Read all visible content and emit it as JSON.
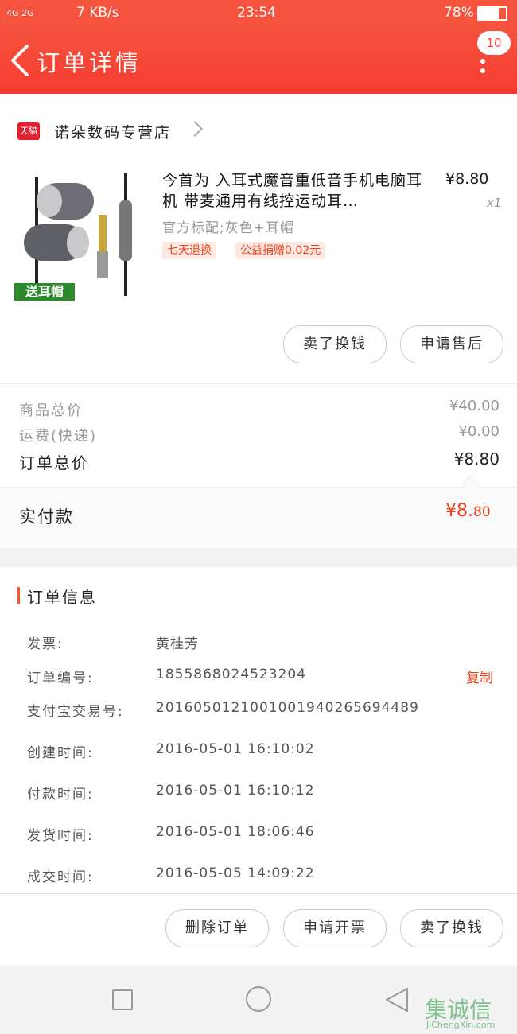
{
  "status_bar": {
    "signal_left": "4G 2G",
    "speed": "7 KB/s",
    "time": "23:54",
    "battery": "78%"
  },
  "header": {
    "title": "订单详情",
    "badge": "10"
  },
  "shop": {
    "logo_text": "天猫",
    "name": "诺朵数码专营店"
  },
  "product": {
    "thumb_label": "送耳帽",
    "name": "今首为 入耳式魔音重低音手机电脑耳机 带麦通用有线控运动耳…",
    "price": "¥8.80",
    "qty": "x1",
    "spec": "官方标配;灰色+耳帽",
    "tags": [
      "七天退换",
      "公益捐赠0.02元"
    ]
  },
  "item_buttons": {
    "sell": "卖了换钱",
    "after_sale": "申请售后"
  },
  "summary": {
    "goods_total_label": "商品总价",
    "goods_total": "¥40.00",
    "shipping_label": "运费(快递)",
    "shipping": "¥0.00",
    "order_total_label": "订单总价",
    "order_total": "¥8.80",
    "paid_label": "实付款",
    "paid_symbol": "¥8.",
    "paid_cents": "80"
  },
  "order_info": {
    "title": "订单信息",
    "copy_label": "复制",
    "rows": [
      {
        "label": "发票:",
        "value": "黄桂芳"
      },
      {
        "label": "订单编号:",
        "value": "1855868024523204"
      },
      {
        "label": "支付宝交易号:",
        "value": "2016050121001001940265694489"
      },
      {
        "label": "创建时间:",
        "value": "2016-05-01 16:10:02"
      },
      {
        "label": "付款时间:",
        "value": "2016-05-01 16:10:12"
      },
      {
        "label": "发货时间:",
        "value": "2016-05-01 18:06:46"
      },
      {
        "label": "成交时间:",
        "value": "2016-05-05 14:09:22"
      }
    ]
  },
  "actions": {
    "delete": "删除订单",
    "invoice": "申请开票",
    "sell": "卖了换钱"
  },
  "watermark": {
    "text": "集诚信",
    "url": "JiChengXin.com"
  },
  "colors": {
    "header": "#f5533d",
    "accent": "#e8411b"
  }
}
